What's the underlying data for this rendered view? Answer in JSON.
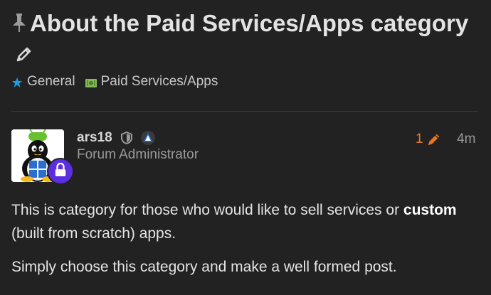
{
  "topic": {
    "title": "About the Paid Services/Apps category",
    "categories": [
      {
        "label": "General",
        "icon": "star-badge-icon",
        "color": "#1e9be0"
      },
      {
        "label": "Paid Services/Apps",
        "icon": "money-icon",
        "color": "#86b85a"
      }
    ]
  },
  "post": {
    "username": "ars18",
    "user_title": "Forum Administrator",
    "edit_count": "1",
    "date": "4m",
    "paragraph1": {
      "before": "This is category for those who would like to sell services or ",
      "bold": "custom",
      "after": " (built from scratch) apps."
    },
    "paragraph2": "Simply choose this category and make a well formed post."
  },
  "colors": {
    "accent_orange": "#e8771f",
    "lock_badge": "#5b2ee0",
    "background": "#222222"
  }
}
